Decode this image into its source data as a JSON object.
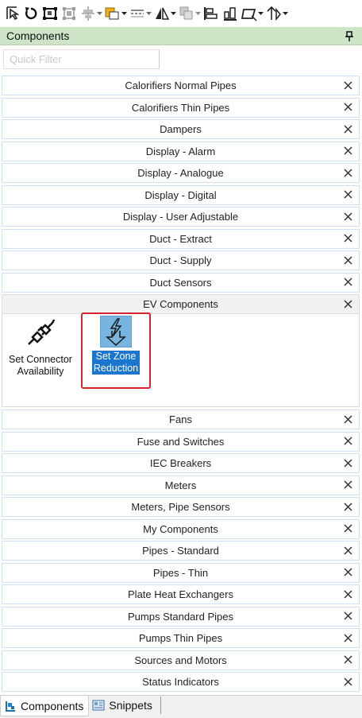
{
  "toolbar": {
    "icons": [
      "select-arrow-icon",
      "rotate-icon",
      "crop-frame-icon",
      "group-icon",
      "align-icon",
      "fill-color-icon",
      "line-style-icon",
      "flip-icon",
      "arrange-icon",
      "align-left-icon",
      "align-right-icon",
      "distribute-icon",
      "flip-vertical-icon"
    ]
  },
  "panel": {
    "title": "Components",
    "filter_placeholder": "Quick Filter",
    "filter_value": ""
  },
  "groups_before": [
    "Calorifiers Normal Pipes",
    "Calorifiers Thin Pipes",
    "Dampers",
    "Display - Alarm",
    "Display - Analogue",
    "Display - Digital",
    "Display - User Adjustable",
    "Duct - Extract",
    "Duct - Supply",
    "Duct Sensors"
  ],
  "open_group": {
    "label": "EV Components",
    "items": [
      {
        "line1": "Set Connector",
        "line2": "Availability",
        "icon": "plug-connector-icon"
      },
      {
        "line1": "Set Zone",
        "line2": "Reduction",
        "icon": "zone-reduction-icon",
        "selected": true
      }
    ]
  },
  "groups_after": [
    "Fans",
    "Fuse and Switches",
    "IEC Breakers",
    "Meters",
    "Meters, Pipe Sensors",
    "My Components",
    "Pipes - Standard",
    "Pipes - Thin",
    "Plate Heat Exchangers",
    "Pumps Standard Pipes",
    "Pumps Thin Pipes",
    "Sources and Motors",
    "Status Indicators"
  ],
  "bottom_tabs": [
    {
      "label": "Components",
      "active": true
    },
    {
      "label": "Snippets",
      "active": false
    }
  ],
  "colors": {
    "title_bar": "#cde5c6",
    "selection": "#1b76d0",
    "highlight_box": "#d6242c"
  }
}
